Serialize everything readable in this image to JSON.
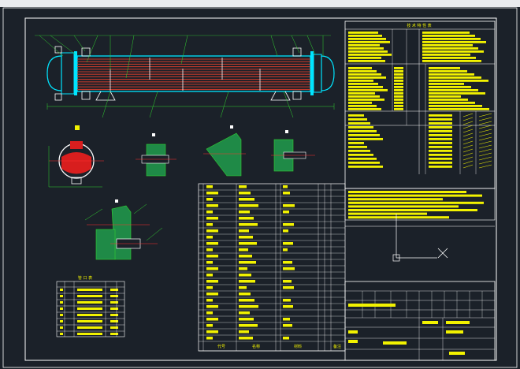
{
  "titles": {
    "tech_table": "技 术 特 性 表",
    "nozzle_table": "管 口 表"
  },
  "parts_header": {
    "code": "代号",
    "name": "名称",
    "material": "材料",
    "remark": "备注"
  },
  "colors": {
    "background": "#1b2129",
    "frame": "#ffffff",
    "text": "#f2f200",
    "shell": "#00e5ff",
    "tube": "#c0392b",
    "weld": "#e02020",
    "leader": "#31d331",
    "centerline": "#ff3030"
  }
}
